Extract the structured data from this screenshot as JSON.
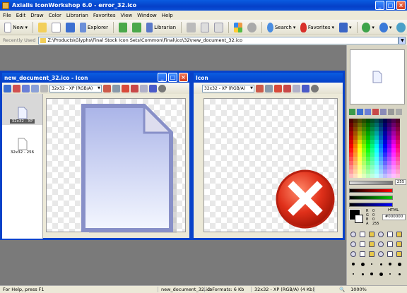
{
  "app": {
    "title": "Axialis IconWorkshop 6.0 - error_32.ico",
    "window_controls": {
      "minimize": "_",
      "maximize": "□",
      "close": "×"
    }
  },
  "menu": [
    "File",
    "Edit",
    "Draw",
    "Color",
    "Librarian",
    "Favorites",
    "View",
    "Window",
    "Help"
  ],
  "toolbar": {
    "new_label": "New",
    "explorer_label": "Explorer",
    "librarian_label": "Librarian",
    "search_label": "Search",
    "favorites_label": "Favorites"
  },
  "address": {
    "label": "Recently Used",
    "path": "Z:\\Products\\Glyphs\\Final Stock Icon Sets\\Common\\Final\\ico\\32\\new_document_32.ico"
  },
  "doc1": {
    "title": "new_document_32.ico - Icon",
    "format": "32x32 - XP (RGB/A)",
    "formats": [
      {
        "label": "32x32 - XP",
        "selected": true
      },
      {
        "label": "32x32 - 256",
        "selected": false
      }
    ]
  },
  "doc2": {
    "title": "Icon",
    "format": "32x32 - XP (RGB/A)"
  },
  "colors": {
    "alpha_value": "255",
    "r_label": "R",
    "g_label": "G",
    "b_label": "B",
    "a_label": "A",
    "rgba_values": [
      "0",
      "0",
      "0",
      "255"
    ],
    "html_label": "HTML",
    "html_value": "#000000",
    "accent": "#0842c9"
  },
  "status": {
    "help": "For Help, press F1",
    "file": "new_document_32.ico",
    "formats": "2 Formats: 6 Kb",
    "format": "32x32 - XP (RGB/A) (4 Kb)",
    "zoom": "1000%"
  }
}
